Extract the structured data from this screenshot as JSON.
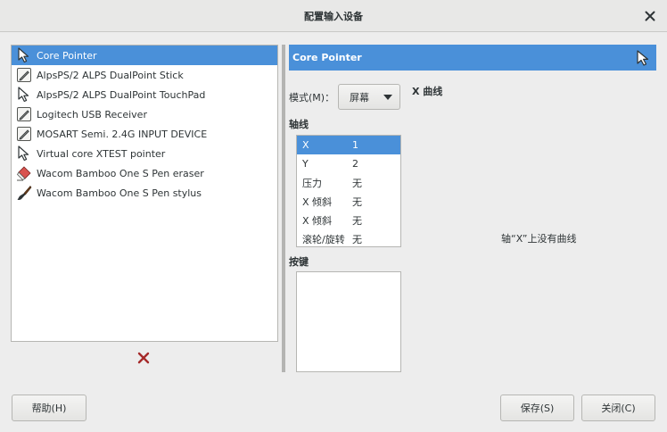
{
  "window": {
    "title": "配置输入设备"
  },
  "devices": [
    {
      "label": "Core Pointer",
      "icon": "cursor-icon",
      "selected": true
    },
    {
      "label": "AlpsPS/2 ALPS DualPoint Stick",
      "icon": "tablet-pen-icon"
    },
    {
      "label": "AlpsPS/2 ALPS DualPoint TouchPad",
      "icon": "cursor-icon"
    },
    {
      "label": "Logitech USB Receiver",
      "icon": "tablet-pen-icon"
    },
    {
      "label": "MOSART Semi. 2.4G INPUT DEVICE",
      "icon": "tablet-pen-icon"
    },
    {
      "label": "Virtual core XTEST pointer",
      "icon": "cursor-icon"
    },
    {
      "label": "Wacom Bamboo One S Pen eraser",
      "icon": "eraser-icon"
    },
    {
      "label": "Wacom Bamboo One S Pen stylus",
      "icon": "brush-icon"
    }
  ],
  "device_panel": {
    "title": "Core Pointer",
    "mode_label": "模式(M)：",
    "mode_value": "屏幕",
    "axes_label": "轴线",
    "axes": [
      {
        "name": "X",
        "value": "1",
        "selected": true
      },
      {
        "name": "Y",
        "value": "2"
      },
      {
        "name": "压力",
        "value": "无"
      },
      {
        "name": "X 倾斜",
        "value": "无"
      },
      {
        "name": "X 倾斜",
        "value": "无"
      },
      {
        "name": "滚轮/旋转",
        "value": "无"
      }
    ],
    "keys_label": "按键",
    "curve_title": "X 曲线",
    "curve_message": "轴“X”上没有曲线"
  },
  "buttons": {
    "help": "帮助(H)",
    "save": "保存(S)",
    "close": "关闭(C)"
  },
  "colors": {
    "selection": "#4a90d9",
    "remove_icon": "#a52a2a"
  }
}
